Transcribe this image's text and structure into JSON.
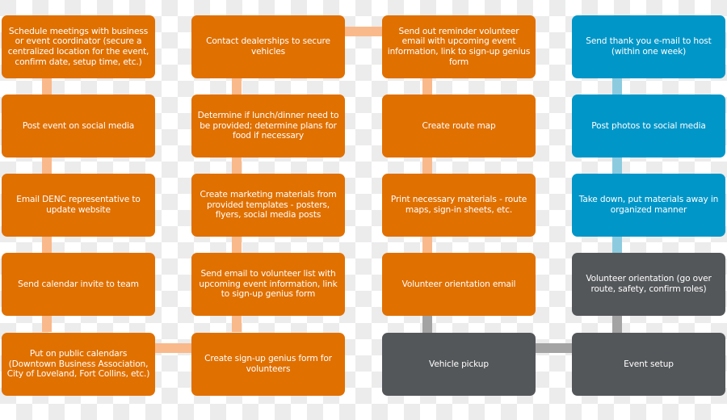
{
  "diagram": {
    "colors": {
      "task": "#e07000",
      "post_event": "#0096c8",
      "event_day": "#54575a",
      "task_connector": "#f9b98a",
      "post_event_connector": "#8ccbdf",
      "event_day_connector": "#a3a3a3"
    },
    "columns": [
      {
        "steps": [
          "Schedule meetings with business or event coordinator (secure a centralized location for the event, confirm date, setup time, etc.)",
          "Post event on social media",
          "Email DENC representative to update website",
          "Send calendar invite to team",
          "Put on public calendars (Downtown Business Association, City of Loveland, Fort Collins, etc.)"
        ]
      },
      {
        "steps": [
          "Contact dealerships to secure vehicles",
          "Determine if lunch/dinner need to be provided; determine plans for food if necessary",
          "Create marketing materials from provided templates - posters, flyers, social media posts",
          "Send email to volunteer list with upcoming event information, link to sign-up genius form",
          "Create sign-up genius form for volunteers"
        ]
      },
      {
        "steps": [
          "Send out reminder volunteer email with upcoming event information, link to sign-up genius form",
          "Create route map",
          "Print necessary materials - route maps, sign-in sheets, etc.",
          "Volunteer orientation email",
          "Vehicle pickup"
        ]
      },
      {
        "steps": [
          "Send thank you e-mail to host (within one week)",
          "Post photos to social media",
          "Take down, put materials away in organized manner",
          "Volunteer orientation (go over route, safety, confirm roles)",
          "Event setup"
        ]
      }
    ]
  }
}
